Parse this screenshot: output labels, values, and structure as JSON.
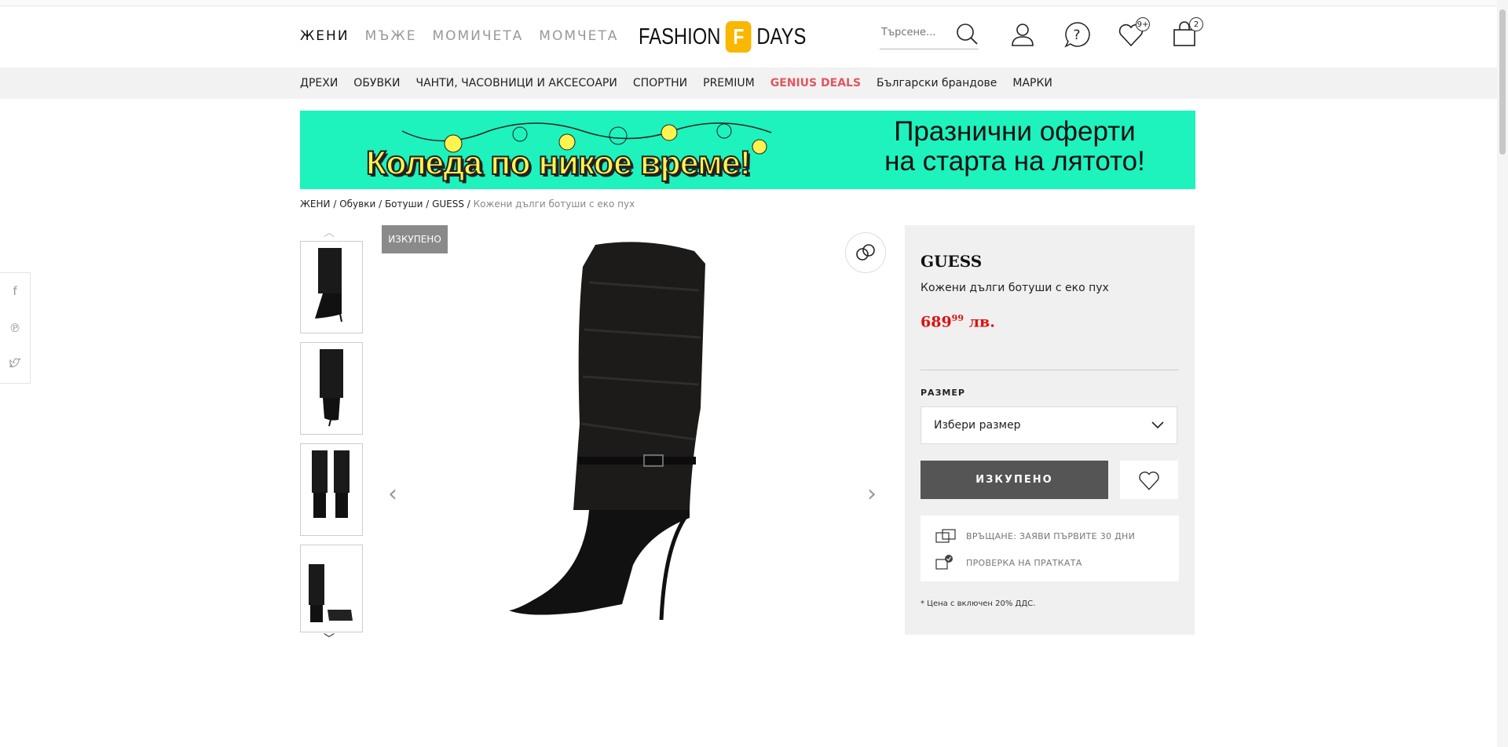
{
  "header": {
    "gender_tabs": [
      "ЖЕНИ",
      "МЪЖЕ",
      "МОМИЧЕТА",
      "МОМЧЕТА"
    ],
    "logo_left": "FASHION",
    "logo_right": "DAYS",
    "search_placeholder": "Търсене...",
    "wishlist_count": "9+",
    "cart_count": "2"
  },
  "categories": [
    "ДРЕХИ",
    "ОБУВКИ",
    "ЧАНТИ, ЧАСОВНИЦИ И АКСЕСОАРИ",
    "СПОРТНИ",
    "PREMIUM",
    "GENIUS DEALS",
    "Български брандове",
    "МАРКИ"
  ],
  "banner": {
    "left_text": "Коледа по никое време!",
    "right_line1": "Празнични оферти",
    "right_line2": "на старта на лятото!"
  },
  "breadcrumb": [
    "ЖЕНИ",
    "Обувки",
    "Ботуши",
    "GUESS"
  ],
  "breadcrumb_current": "Кожени дълги ботуши с еко пух",
  "product": {
    "sold_tag": "ИЗКУПЕНО",
    "brand": "GUESS",
    "name": "Кожени дълги ботуши с еко пух",
    "price_main": "689",
    "price_cents": "99",
    "price_currency": "лв.",
    "size_label": "РАЗМЕР",
    "size_placeholder": "Избери размер",
    "sold_button": "ИЗКУПЕНО",
    "info_return": "ВРЪЩАНЕ: ЗАЯВИ ПЪРВИТЕ 30 ДНИ",
    "info_check": "ПРОВЕРКА НА ПРАТКАТА",
    "vat_note": "* Цена с включен 20% ДДС."
  },
  "colors": {
    "accent_deal": "#e2565f",
    "price": "#dd1111",
    "banner_bg": "#1ef2bd",
    "logo_mark": "#f9b700"
  }
}
